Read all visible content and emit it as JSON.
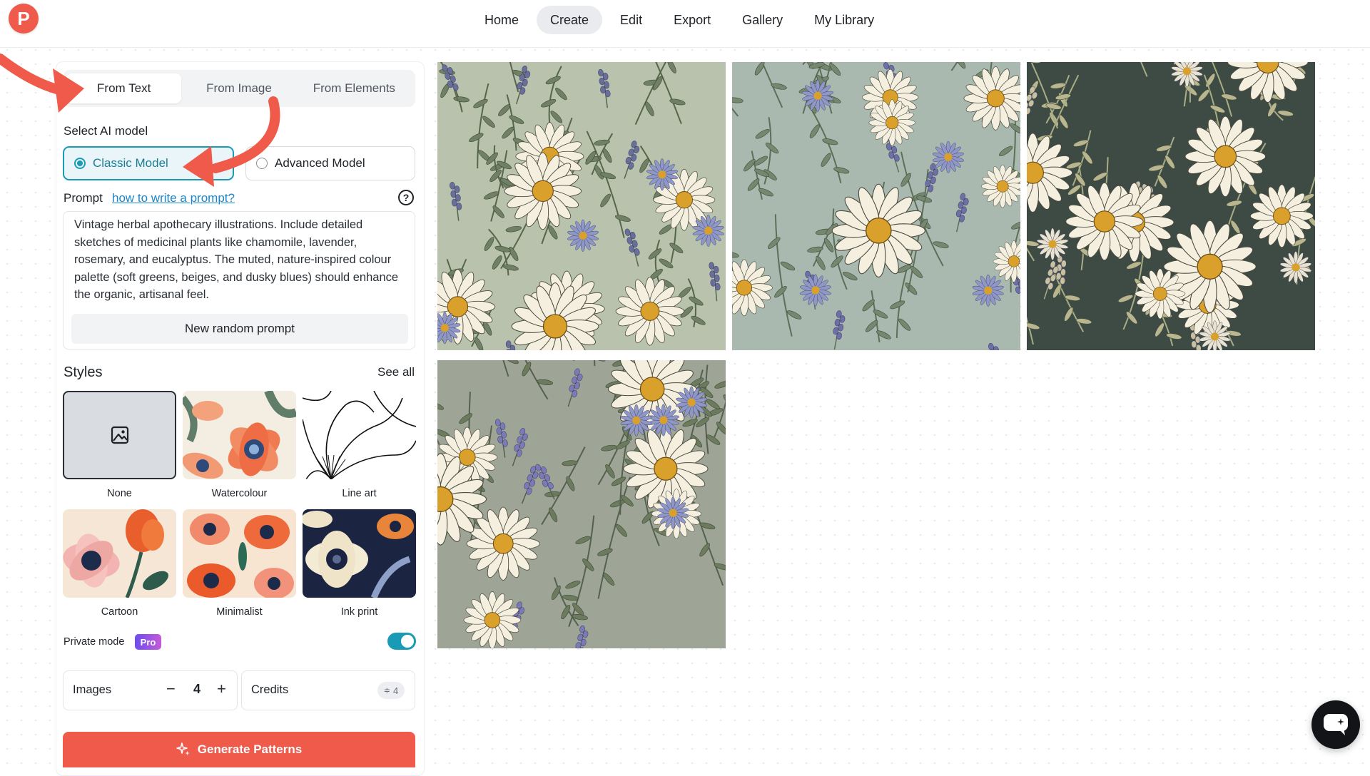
{
  "app": {
    "logo_letter": "P"
  },
  "nav": {
    "items": [
      {
        "label": "Home"
      },
      {
        "label": "Create",
        "active": true
      },
      {
        "label": "Edit"
      },
      {
        "label": "Export"
      },
      {
        "label": "Gallery"
      },
      {
        "label": "My Library"
      }
    ]
  },
  "tabs": [
    {
      "label": "From Text",
      "active": true
    },
    {
      "label": "From Image"
    },
    {
      "label": "From Elements"
    }
  ],
  "model": {
    "heading": "Select AI model",
    "options": [
      {
        "label": "Classic Model",
        "selected": true
      },
      {
        "label": "Advanced Model",
        "selected": false
      }
    ]
  },
  "prompt": {
    "label": "Prompt",
    "help_link": "how to write a prompt?",
    "text": "Vintage herbal apothecary illustrations. Include detailed sketches of medicinal plants like chamomile, lavender, rosemary, and eucalyptus. The muted, nature-inspired colour palette (soft greens, beiges, and dusky blues) should enhance the organic, artisanal feel.",
    "random_button": "New random prompt"
  },
  "styles": {
    "title": "Styles",
    "see_all": "See all",
    "items": [
      {
        "label": "None",
        "selected": true
      },
      {
        "label": "Watercolour"
      },
      {
        "label": "Line art"
      },
      {
        "label": "Cartoon"
      },
      {
        "label": "Minimalist"
      },
      {
        "label": "Ink print"
      }
    ]
  },
  "private_mode": {
    "label": "Private mode",
    "badge": "Pro",
    "enabled": true
  },
  "images": {
    "label": "Images",
    "count": "4",
    "minus": "−",
    "plus": "+"
  },
  "credits": {
    "label": "Credits",
    "value": "4"
  },
  "generate": {
    "label": "Generate Patterns"
  },
  "gallery": {
    "items": [
      {
        "name": "herbal-pattern-1",
        "bg": "#b9c2ad"
      },
      {
        "name": "herbal-pattern-2",
        "bg": "#a9b9b0"
      },
      {
        "name": "herbal-pattern-3",
        "bg": "#3e4b44"
      },
      {
        "name": "herbal-pattern-4",
        "bg": "#9ea596"
      }
    ]
  },
  "colors": {
    "accent": "#f05a4a",
    "teal": "#1a9bb5",
    "pro_gradient_start": "#6d4cf0",
    "pro_gradient_end": "#c35ad8"
  },
  "icons": [
    "logo-icon",
    "help-icon",
    "image-placeholder-icon",
    "sparkle-icon",
    "chat-icon",
    "arrow-icon"
  ]
}
